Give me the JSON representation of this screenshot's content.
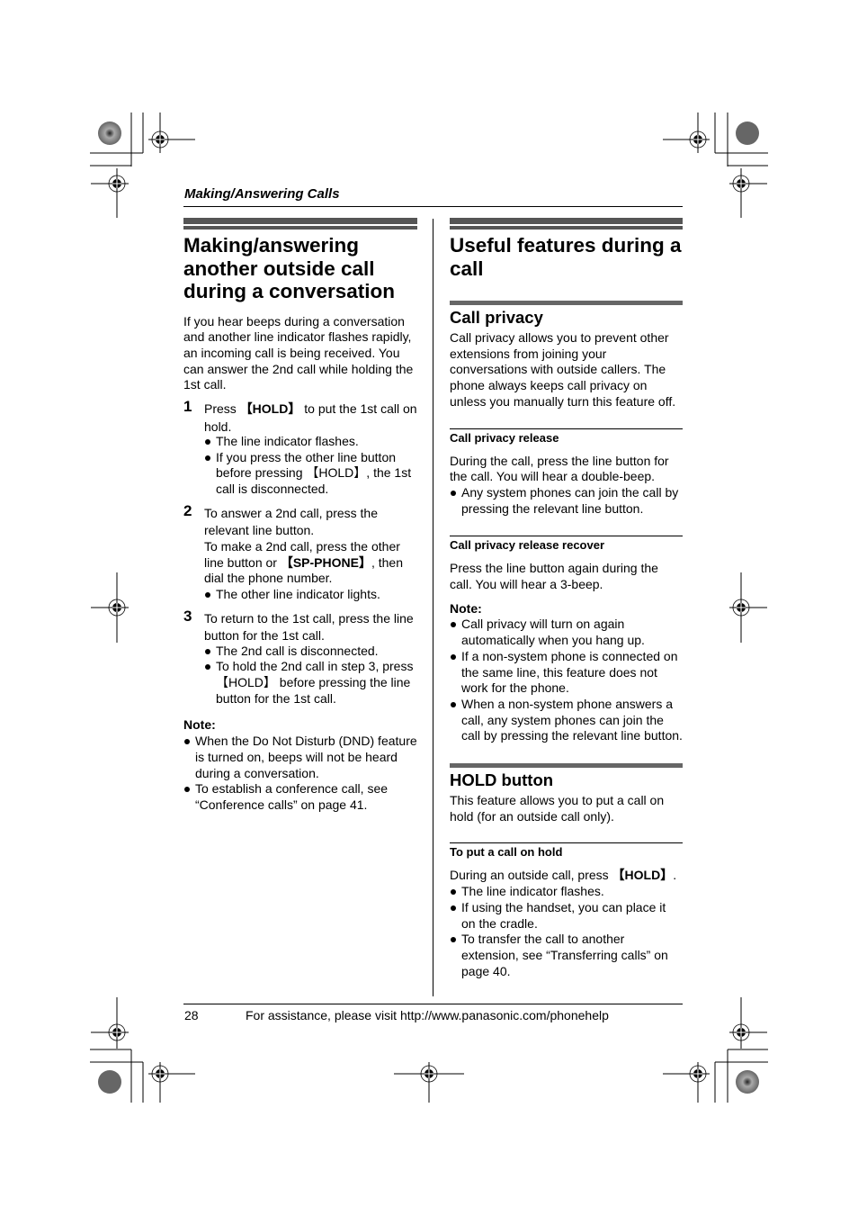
{
  "running_head": "Making/Answering Calls",
  "left": {
    "title": "Making/answering another outside call during a conversation",
    "intro": "If you hear beeps during a conversation and another line indicator flashes rapidly, an incoming call is being received. You can answer the 2nd call while holding the 1st call.",
    "steps": [
      {
        "num": "1",
        "text_before": "Press ",
        "key": "【HOLD】",
        "text_after": " to put the 1st call on hold.",
        "bullets": [
          "The line indicator flashes.",
          "If you press the other line button before pressing 【HOLD】, the 1st call is disconnected."
        ]
      },
      {
        "num": "2",
        "line1": "To answer a 2nd call, press the relevant line button.",
        "text_before": "To make a 2nd call, press the other line button or ",
        "key": "【SP-PHONE】",
        "text_after": ", then dial the phone number.",
        "bullets": [
          "The other line indicator lights."
        ]
      },
      {
        "num": "3",
        "line1": "To return to the 1st call, press the line button for the 1st call.",
        "bullets": [
          "The 2nd call is disconnected.",
          "To hold the 2nd call in step 3, press 【HOLD】 before pressing the line button for the 1st call."
        ]
      }
    ],
    "note_label": "Note:",
    "notes": [
      "When the Do Not Disturb (DND) feature is turned on, beeps will not be heard during a conversation.",
      "To establish a conference call, see “Conference calls” on page 41."
    ]
  },
  "right": {
    "title": "Useful features during a call",
    "call_privacy": {
      "heading": "Call privacy",
      "body": "Call privacy allows you to prevent other extensions from joining your conversations with outside callers. The phone always keeps call privacy on unless you manually turn this feature off.",
      "release": {
        "heading": "Call privacy release",
        "body": "During the call, press the line button for the call. You will hear a double-beep.",
        "bullets": [
          "Any system phones can join the call by pressing the relevant line button."
        ]
      },
      "recover": {
        "heading": "Call privacy release recover",
        "body": "Press the line button again during the call. You will hear a 3-beep."
      },
      "note_label": "Note:",
      "notes": [
        "Call privacy will turn on again automatically when you hang up.",
        "If a non-system phone is connected on the same line, this feature does not work for the phone.",
        "When a non-system phone answers a call, any system phones can join the call by pressing the relevant line button."
      ]
    },
    "hold_button": {
      "heading": "HOLD button",
      "body": "This feature allows you to put a call on hold (for an outside call only).",
      "sub_heading": "To put a call on hold",
      "text_before": "During an outside call, press ",
      "key": "【HOLD】",
      "text_after": ".",
      "bullets": [
        "The line indicator flashes.",
        "If using the handset, you can place it on the cradle.",
        "To transfer the call to another extension, see “Transferring calls” on page 40."
      ]
    }
  },
  "footer": {
    "page_number": "28",
    "text": "For assistance, please visit http://www.panasonic.com/phonehelp"
  }
}
